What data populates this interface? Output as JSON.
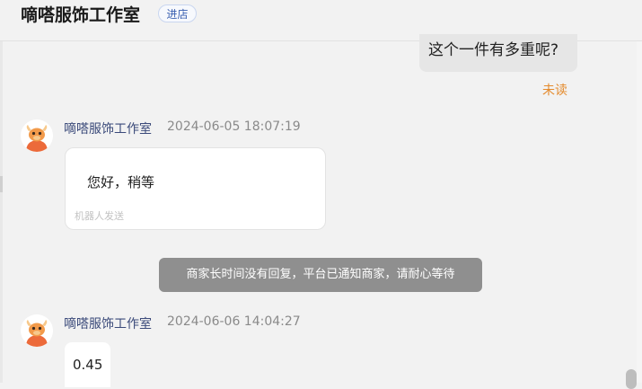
{
  "header": {
    "store_name": "嘀嗒服饰工作室",
    "enter_label": "进店"
  },
  "messages": [
    {
      "type": "outgoing",
      "text": "这个一件有多重呢?",
      "status": "未读"
    },
    {
      "type": "incoming",
      "sender": "嘀嗒服饰工作室",
      "timestamp": "2024-06-05 18:07:19",
      "text": "您好，稍等",
      "note": "机器人发送"
    },
    {
      "type": "system",
      "text": "商家长时间没有回复，平台已通知商家，请耐心等待"
    },
    {
      "type": "incoming",
      "sender": "嘀嗒服饰工作室",
      "timestamp": "2024-06-06 14:04:27",
      "text": "0.45"
    }
  ],
  "colors": {
    "background": "#f2f2f2",
    "unread": "#e48a2c",
    "sender_name": "#3b4a7a",
    "system_notice_bg": "#8f8f8f",
    "enter_button_text": "#3a5fb0",
    "avatar_accent": "#ec6a3a"
  },
  "icons": {
    "avatar": "bull-mascot-icon"
  }
}
